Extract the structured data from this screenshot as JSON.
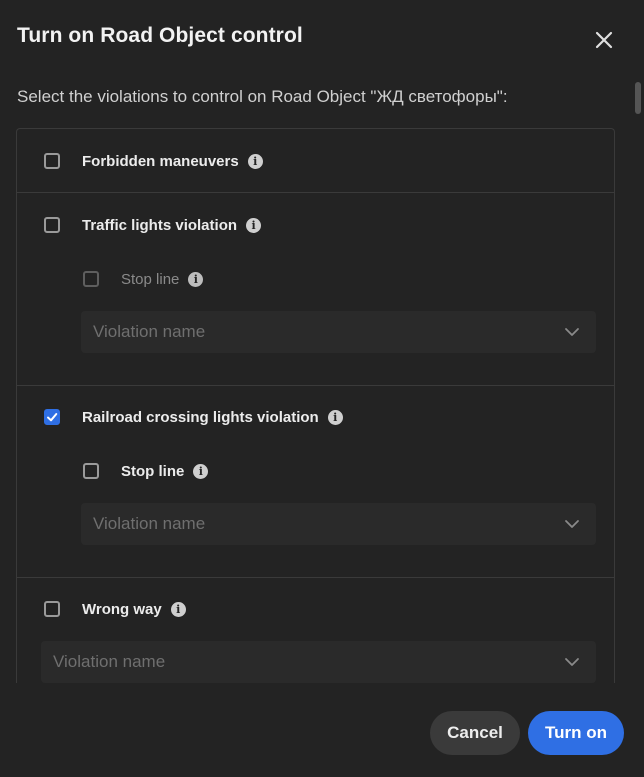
{
  "dialog": {
    "title": "Turn on Road Object control",
    "subtitle": "Select the violations to control on Road Object \"ЖД светофоры\":",
    "cancel_label": "Cancel",
    "confirm_label": "Turn on"
  },
  "violations": [
    {
      "label": "Forbidden maneuvers",
      "checked": false
    },
    {
      "label": "Traffic lights violation",
      "checked": false,
      "stop_line": {
        "label": "Stop line",
        "checked": false,
        "disabled": true
      },
      "select_placeholder": "Violation name"
    },
    {
      "label": "Railroad crossing lights violation",
      "checked": true,
      "stop_line": {
        "label": "Stop line",
        "checked": false,
        "disabled": false
      },
      "select_placeholder": "Violation name"
    },
    {
      "label": "Wrong way",
      "checked": false,
      "select_placeholder": "Violation name"
    }
  ],
  "icons": {
    "close": "close-icon",
    "info": "info-icon",
    "chevron": "chevron-down-icon",
    "check": "check-icon"
  },
  "colors": {
    "accent": "#2f6fe4",
    "background": "#232323",
    "border": "#3a3a3a"
  }
}
